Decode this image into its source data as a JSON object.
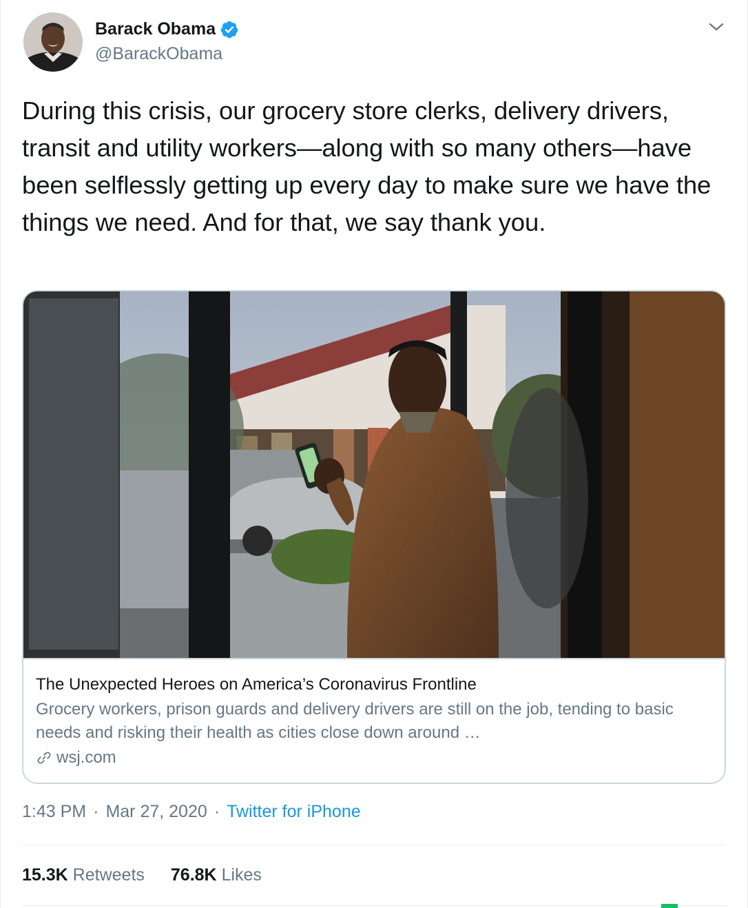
{
  "author": {
    "name": "Barack Obama",
    "handle": "@BarackObama",
    "verified": true
  },
  "tweet": {
    "text": "During this crisis, our grocery store clerks, delivery drivers, transit and utility workers—along with so many others—have been selflessly getting up every day to make sure we have the things we need. And for that, we say thank you."
  },
  "card": {
    "title": "The Unexpected Heroes on America’s Coronavirus Frontline",
    "description": "Grocery workers, prison guards and delivery drivers are still on the job, tending to basic needs and risking their health as cities close down around …",
    "domain": "wsj.com",
    "link_icon": "link-icon"
  },
  "meta": {
    "time": "1:43 PM",
    "separator": "·",
    "date": "Mar 27, 2020",
    "source": "Twitter for iPhone"
  },
  "stats": {
    "retweets_count": "15.3K",
    "retweets_label": "Retweets",
    "likes_count": "76.8K",
    "likes_label": "Likes"
  },
  "colors": {
    "verified_blue": "#1da1f2",
    "link_blue": "#1b95e0",
    "secondary_text": "#657786",
    "border": "#ccd6dd"
  }
}
